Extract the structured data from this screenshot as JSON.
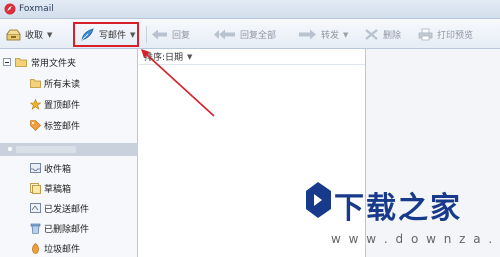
{
  "window": {
    "title": "Foxmail"
  },
  "toolbar": {
    "receive": "收取",
    "compose": "写邮件",
    "reply": "回复",
    "reply_all": "回复全部",
    "forward": "转发",
    "delete": "删除",
    "print_preview": "打印预览",
    "dropdown_glyph": "▼"
  },
  "sidebar": {
    "common_folder": "常用文件夹",
    "common_items": [
      "所有未读",
      "置顶邮件",
      "标签邮件"
    ],
    "account_items": [
      "收件箱",
      "草稿箱",
      "已发送邮件",
      "已删除邮件",
      "垃圾邮件"
    ]
  },
  "list": {
    "sort_label": "排序:日期",
    "sort_caret": "▼"
  },
  "watermark": {
    "logo_text": "下载之家",
    "url": "w w w . d o w n z a . c n"
  },
  "colors": {
    "highlight": "#d7202a",
    "brand_blue": "#173a8a",
    "toolbar": "#e6edf6",
    "sidebar": "#f6f8fb"
  },
  "icons": [
    "foxmail-logo-icon",
    "receive-icon",
    "compose-pen-icon",
    "reply-icon",
    "reply-all-icon",
    "forward-icon",
    "delete-icon",
    "printer-icon",
    "folder-icon",
    "star-icon",
    "tag-icon",
    "inbox-icon",
    "drafts-icon",
    "sent-icon",
    "trash-icon",
    "junk-icon"
  ]
}
